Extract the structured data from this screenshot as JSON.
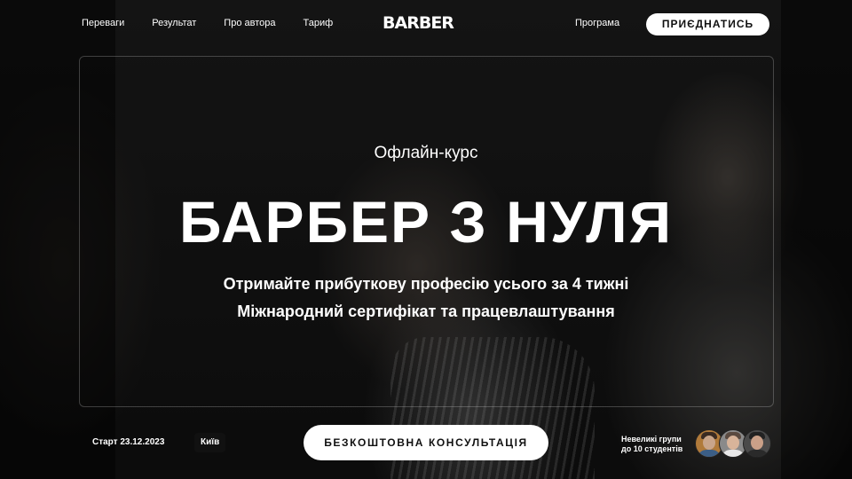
{
  "nav": {
    "links": [
      "Переваги",
      "Результат",
      "Про автора",
      "Тариф"
    ],
    "program": "Програма",
    "join_label": "ПРИЄДНАТИСЬ"
  },
  "logo": {
    "text": "BARBER"
  },
  "hero": {
    "eyebrow": "Офлайн-курс",
    "title": "БАРБЕР З НУЛЯ",
    "subtitle_line1": "Отримайте прибуткову професію усього за 4 тижні",
    "subtitle_line2": "Міжнародний сертифікат та працевлаштування"
  },
  "footer": {
    "start_date": "Старт 23.12.2023",
    "city": "Київ",
    "consult_label": "БЕЗКОШТОВНА КОНСУЛЬТАЦІЯ",
    "groups_line1": "Невеликі групи",
    "groups_line2": "до 10 студентів"
  },
  "colors": {
    "background": "#141414",
    "button_bg": "#ffffff",
    "button_text": "#111111",
    "text": "#ffffff"
  },
  "icons": [
    "student-avatar-1",
    "student-avatar-2",
    "student-avatar-3"
  ]
}
